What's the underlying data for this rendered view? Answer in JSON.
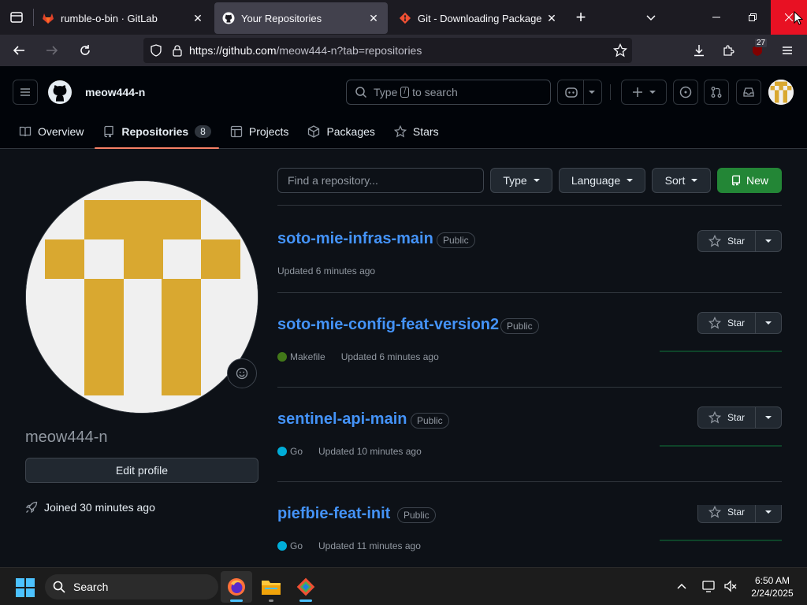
{
  "browser": {
    "tabs": [
      {
        "title": "rumble-o-bin · GitLab",
        "icon": "gitlab-icon",
        "active": false
      },
      {
        "title": "Your Repositories",
        "icon": "github-icon",
        "active": true
      },
      {
        "title": "Git - Downloading Package",
        "icon": "git-icon",
        "active": false
      }
    ],
    "url": {
      "host": "https://github.com",
      "path": "/meow444-n?tab=repositories"
    },
    "extension_badge": "27"
  },
  "github": {
    "username": "meow444-n",
    "search_placeholder_pre": "Type",
    "search_placeholder_key": "/",
    "search_placeholder_post": "to search",
    "subnav": [
      {
        "label": "Overview",
        "icon": "book-icon"
      },
      {
        "label": "Repositories",
        "icon": "repo-icon",
        "count": "8",
        "selected": true
      },
      {
        "label": "Projects",
        "icon": "table-icon"
      },
      {
        "label": "Packages",
        "icon": "package-icon"
      },
      {
        "label": "Stars",
        "icon": "star-icon"
      }
    ]
  },
  "profile": {
    "login": "meow444-n",
    "edit_label": "Edit profile",
    "joined": "Joined 30 minutes ago"
  },
  "filters": {
    "find_placeholder": "Find a repository...",
    "type_label": "Type",
    "language_label": "Language",
    "sort_label": "Sort",
    "new_label": "New"
  },
  "repos": [
    {
      "name": "soto-mie-infras-main",
      "visibility": "Public",
      "language": "",
      "lang_color": "",
      "updated": "Updated 6 minutes ago",
      "star_label": "Star"
    },
    {
      "name": "soto-mie-config-feat-version2",
      "visibility": "Public",
      "language": "Makefile",
      "lang_color": "#427819",
      "updated": "Updated 6 minutes ago",
      "star_label": "Star"
    },
    {
      "name": "sentinel-api-main",
      "visibility": "Public",
      "language": "Go",
      "lang_color": "#00ADD8",
      "updated": "Updated 10 minutes ago",
      "star_label": "Star"
    },
    {
      "name": "piefbie-feat-init",
      "visibility": "Public",
      "language": "Go",
      "lang_color": "#00ADD8",
      "updated": "Updated 11 minutes ago",
      "star_label": "Star"
    }
  ],
  "taskbar": {
    "search_label": "Search",
    "time": "6:50 AM",
    "date": "2/24/2025"
  },
  "colors": {
    "accent_link": "#4493f8",
    "primary_button": "#238636",
    "avatar_gold": "#d9a830"
  }
}
